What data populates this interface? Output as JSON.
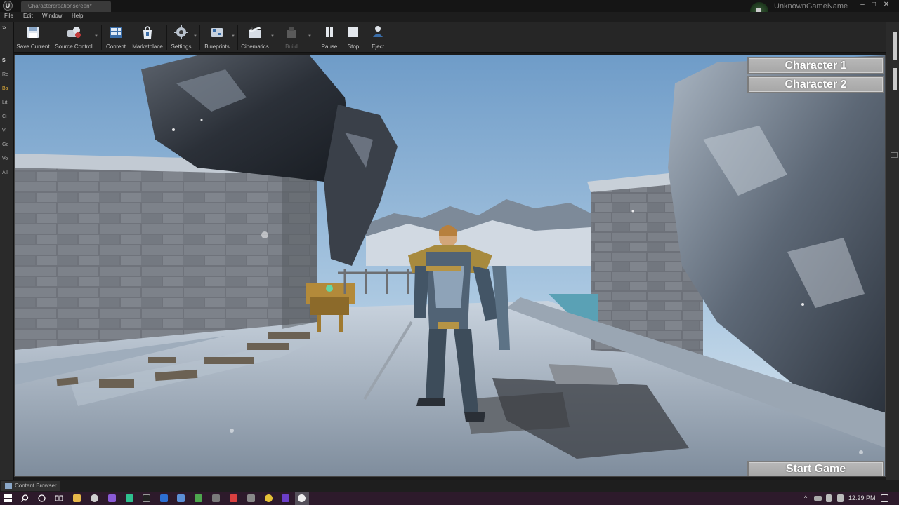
{
  "window": {
    "tab_title": "Charactercreationscreen*",
    "game_name": "UnknownGameName",
    "controls": [
      "–",
      "□",
      "✕"
    ]
  },
  "menu": [
    "File",
    "Edit",
    "Window",
    "Help"
  ],
  "toolbar": [
    {
      "label": "Save Current",
      "icon": "save-icon",
      "enabled": true
    },
    {
      "label": "Source Control",
      "icon": "source-control-icon",
      "enabled": true
    },
    {
      "label": "Content",
      "icon": "content-icon",
      "enabled": true
    },
    {
      "label": "Marketplace",
      "icon": "marketplace-icon",
      "enabled": true
    },
    {
      "label": "Settings",
      "icon": "settings-icon",
      "enabled": true
    },
    {
      "label": "Blueprints",
      "icon": "blueprints-icon",
      "enabled": true
    },
    {
      "label": "Cinematics",
      "icon": "cinematics-icon",
      "enabled": true
    },
    {
      "label": "Build",
      "icon": "build-icon",
      "enabled": false
    },
    {
      "label": "Pause",
      "icon": "pause-icon",
      "enabled": true
    },
    {
      "label": "Stop",
      "icon": "stop-icon",
      "enabled": true
    },
    {
      "label": "Eject",
      "icon": "eject-icon",
      "enabled": true
    }
  ],
  "left_tabs": [
    "Re",
    "Ba",
    "Lit",
    "Ci",
    "Vi",
    "Ge",
    "Vo",
    "All"
  ],
  "viewport": {
    "character_1": "Character 1",
    "character_2": "Character 2",
    "start_game": "Start Game"
  },
  "status": {
    "content_browser": "Content Browser"
  },
  "taskbar": {
    "time": "12:29 PM"
  },
  "colors": {
    "sky": "#8fb6d8",
    "accent": "#3a6da8",
    "button": "#b0b0b0"
  }
}
